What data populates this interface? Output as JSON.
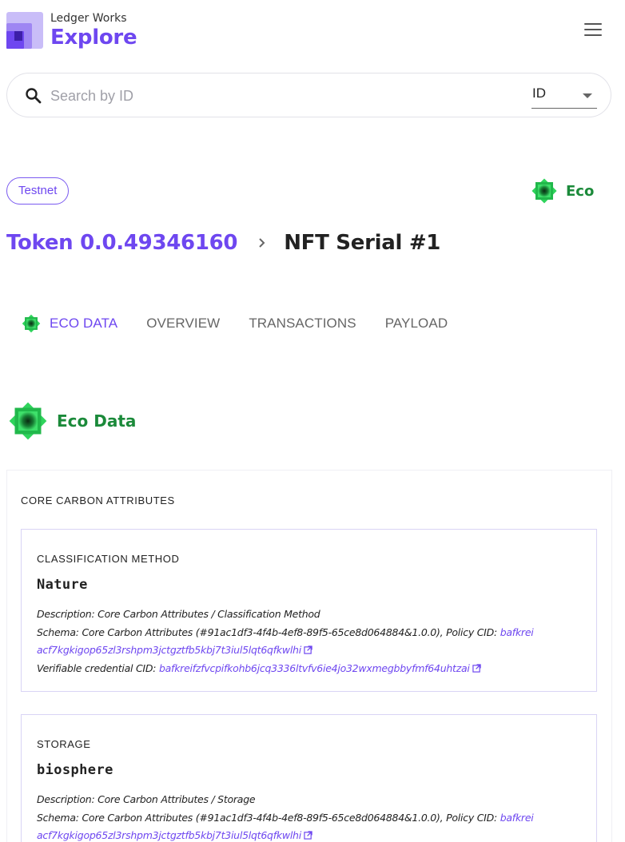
{
  "header": {
    "brand_small": "Ledger Works",
    "brand_big": "Explore",
    "menu_icon": "hamburger-menu-icon",
    "accent_color": "#6e47f0"
  },
  "search": {
    "placeholder": "Search by ID",
    "value": "",
    "type_selected": "ID",
    "icon": "search-icon"
  },
  "network_chip": "Testnet",
  "eco_badge": {
    "label": "Eco",
    "icon": "eco-icon",
    "color": "#1b8a3a"
  },
  "title": {
    "token": "Token 0.0.49346160",
    "separator_icon": "chevron-right-icon",
    "serial": "NFT Serial #1"
  },
  "tabs": [
    {
      "label": "ECO DATA",
      "active": true,
      "icon": "eco-icon"
    },
    {
      "label": "OVERVIEW",
      "active": false
    },
    {
      "label": "TRANSACTIONS",
      "active": false
    },
    {
      "label": "PAYLOAD",
      "active": false
    }
  ],
  "eco_section": {
    "heading": "Eco Data",
    "group_title": "CORE CARBON ATTRIBUTES",
    "cards": [
      {
        "label": "CLASSIFICATION METHOD",
        "value": "Nature",
        "description_label": "Description:",
        "description": "Core Carbon Attributes / Classification Method",
        "schema_label": "Schema:",
        "schema": "Core Carbon Attributes (#91ac1df3-4f4b-4ef8-89f5-65ce8d064884&1.0.0),",
        "policy_label": "Policy CID:",
        "policy_cid_part1": "bafkrei",
        "policy_cid_part2": "acf7kgkigop65zl3rshpm3jctgztfb5kbj7t3iul5lqt6qfkwlhi",
        "vc_label": "Verifiable credential CID:",
        "vc_cid": "bafkreifzfvcpifkohb6jcq3336ltvfv6ie4jo32wxmegbbyfmf64uhtzai"
      },
      {
        "label": "STORAGE",
        "value": "biosphere",
        "description_label": "Description:",
        "description": "Core Carbon Attributes / Storage",
        "schema_label": "Schema:",
        "schema": "Core Carbon Attributes (#91ac1df3-4f4b-4ef8-89f5-65ce8d064884&1.0.0),",
        "policy_label": "Policy CID:",
        "policy_cid_part1": "bafkrei",
        "policy_cid_part2": "acf7kgkigop65zl3rshpm3jctgztfb5kbj7t3iul5lqt6qfkwlhi"
      }
    ]
  }
}
